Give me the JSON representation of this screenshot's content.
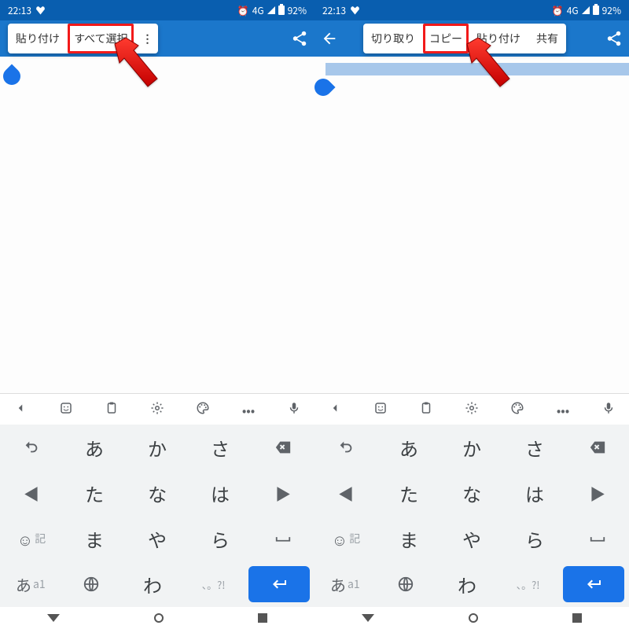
{
  "status": {
    "time": "22:13",
    "net": "4G",
    "battery": "92%"
  },
  "left": {
    "ctx": {
      "paste": "貼り付け",
      "select_all": "すべて選択"
    }
  },
  "right": {
    "ctx": {
      "cut": "切り取り",
      "copy": "コピー",
      "paste": "貼り付け",
      "share": "共有"
    }
  },
  "kbd": {
    "row1": {
      "k1": "あ",
      "k2": "か",
      "k3": "さ"
    },
    "row2": {
      "k1": "た",
      "k2": "な",
      "k3": "は"
    },
    "row3": {
      "mode": "記",
      "k1": "ま",
      "k2": "や",
      "k3": "ら"
    },
    "row4": {
      "mode_a": "あ",
      "mode_b": "a1",
      "k2": "わ"
    }
  }
}
